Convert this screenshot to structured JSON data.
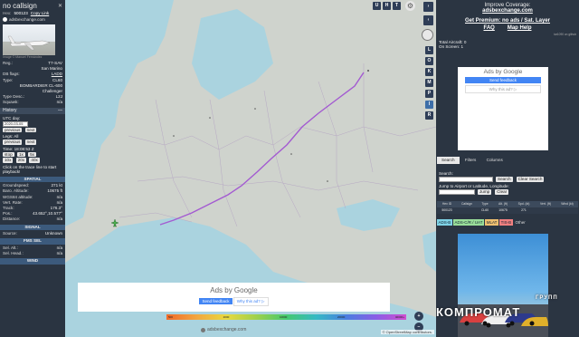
{
  "left": {
    "callsign": "no callsign",
    "hex_label": "Hex:",
    "hex": "500123",
    "copy_link": "Copy Link",
    "site": "adsbexchange.com",
    "photo_credit": "Image © Manuel Fernández",
    "info": [
      {
        "k": "Reg.:",
        "v": "T7-SAV"
      },
      {
        "k": "",
        "v": "San Marino"
      },
      {
        "k": "DB flags:",
        "v": "LADD"
      },
      {
        "k": "Type:",
        "v": "CL60"
      },
      {
        "k": "",
        "v": "BOMBARDIER CL-600"
      },
      {
        "k": "",
        "v": "Challenger"
      },
      {
        "k": "Type Desc.:",
        "v": "L2J"
      },
      {
        "k": "Squawk:",
        "v": "n/a"
      }
    ],
    "history_title": "History",
    "history_toggle": "—",
    "utc_label": "UTC day:",
    "utc_value": "2020-03-05",
    "prev": "previous",
    "next": "next",
    "legs_label": "Legs: All",
    "time_label": "Time: 18:08:53 Z",
    "speed_buttons": [
      "stop",
      "1x",
      "5x"
    ],
    "speed_buttons2": [
      "10x",
      "20x",
      "40x"
    ],
    "playback_hint": "Click on the trace line to start playback!",
    "spatial_title": "SPATIAL",
    "spatial": [
      {
        "k": "Groundspeed:",
        "v": "271 kt"
      },
      {
        "k": "Baro. Altitude:",
        "v": "10675 ft"
      },
      {
        "k": "WGS84 altitude:",
        "v": "n/a"
      },
      {
        "k": "Vert. Rate:",
        "v": "n/a"
      },
      {
        "k": "Track:",
        "v": "176.3°"
      },
      {
        "k": "Pos.:",
        "v": "43.652°,10.577°"
      },
      {
        "k": "Distance:",
        "v": "n/a"
      }
    ],
    "signal_title": "SIGNAL",
    "signal": [
      {
        "k": "Source:",
        "v": "Unknown"
      }
    ],
    "fms_title": "FMS SEL",
    "fms": [
      {
        "k": "Sel. Alt.:",
        "v": "n/a"
      },
      {
        "k": "Sel. Head.:",
        "v": "n/a"
      }
    ],
    "wind_title": "WIND"
  },
  "map": {
    "top_buttons": [
      "U",
      "H",
      "T"
    ],
    "side_buttons": [
      "L",
      "O",
      "K",
      "M",
      "P",
      "I",
      "R"
    ],
    "ad_brand": "Ads by Google",
    "ad_send": "Send feedback",
    "ad_why": "Why this ad? ▷",
    "attribution": "© OpenStreetMap contributors.",
    "watermark_site": "adsbexchange.com",
    "zoom_in": "+",
    "zoom_out": "−",
    "altitude_scale": [
      "500",
      "",
      "2000",
      "",
      "10000",
      "",
      "20000",
      "",
      "40000+"
    ]
  },
  "right": {
    "improve": "Improve Coverage:",
    "improve_link": "adsbexchange.com",
    "premium": "Get Premium: no ads / Sat. Layer",
    "faq": "FAQ",
    "map_help": "Map Help",
    "version": "tar1090 on github",
    "total_aircraft": "Total Aircraft: 0",
    "on_screen": "On Screen: 1",
    "ad_brand": "Ads by Google",
    "ad_send": "Send feedback",
    "ad_why": "Why this ad? ▷",
    "tabs": [
      "Search",
      "Filters",
      "Columns"
    ],
    "search_label": "Search:",
    "search_btn": "Search",
    "clear_search_btn": "Clear Search",
    "jump_label": "Jump to Airport or Latitude, Longitude:",
    "jump_btn": "Jump",
    "clear_btn": "Clear",
    "table_headers": [
      "Hex ID",
      "Callsign",
      "Type",
      "Alt. (ft)",
      "Spd. (kt)",
      "Vert. (ft)",
      "Wind (kt)"
    ],
    "table_row": [
      "500123",
      "",
      "CL60",
      "10675",
      "271",
      "",
      ""
    ],
    "legend": [
      {
        "label": "ADS-B",
        "color": "#7fd3e6"
      },
      {
        "label": "ADS-C/R / UAT",
        "color": "#9adf9a"
      },
      {
        "label": "MLAT",
        "color": "#f0c070"
      },
      {
        "label": "TIS-B",
        "color": "#f08080"
      },
      {
        "label": "Other",
        "color": "#2b3542"
      }
    ],
    "watermark_small": "ГРУПП",
    "watermark_big": "КОМПРОМАТ"
  }
}
